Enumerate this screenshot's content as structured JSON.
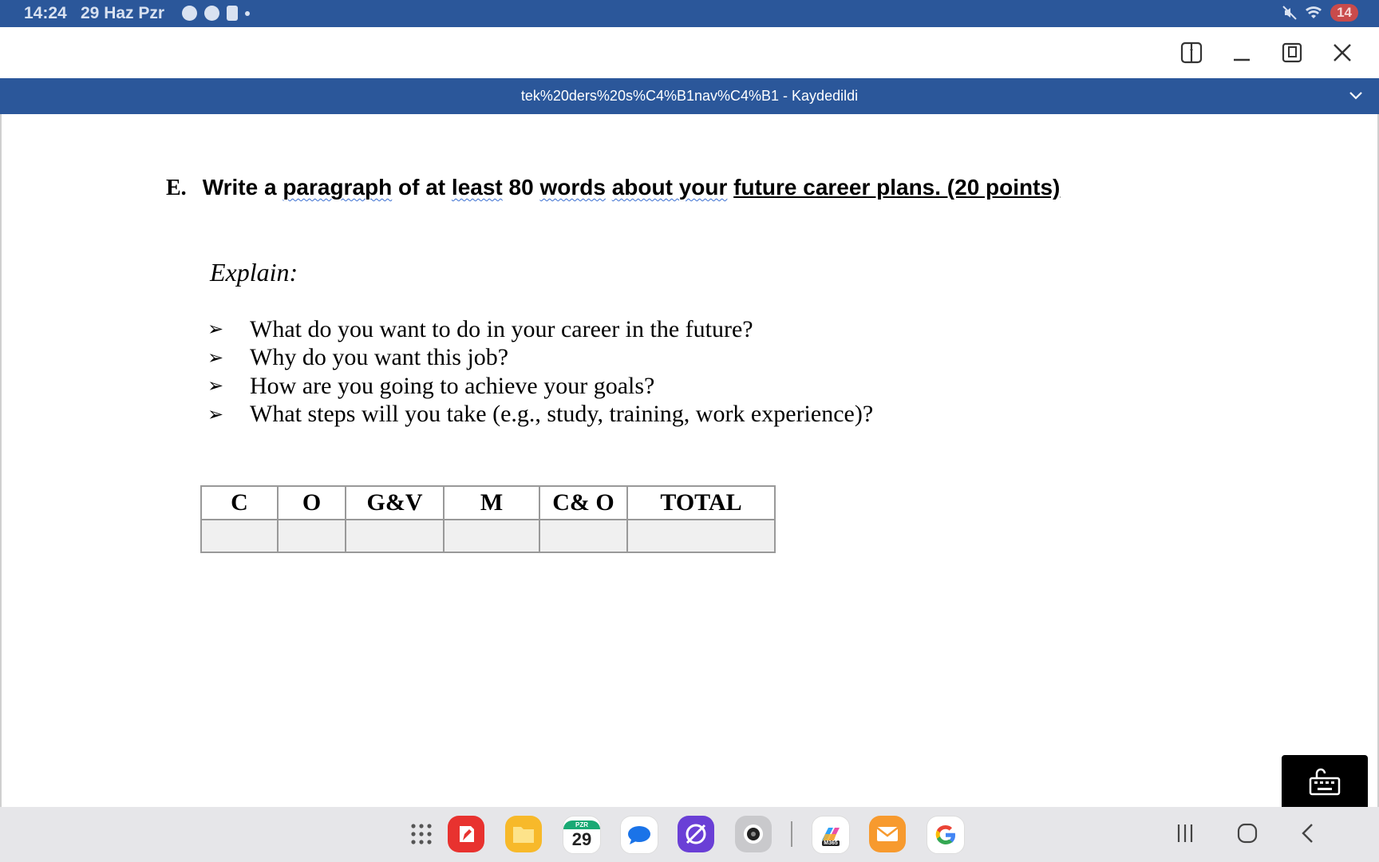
{
  "status_bar": {
    "time": "14:24",
    "date": "29 Haz Pzr",
    "battery": "14"
  },
  "title_bar": {
    "title": "tek%20ders%20s%C4%B1nav%C4%B1 - Kaydedildi"
  },
  "document": {
    "question_letter": "E.",
    "heading_parts": [
      {
        "text": "Write a ",
        "style": "plain"
      },
      {
        "text": "paragraph",
        "style": "wavy"
      },
      {
        "text": " of at ",
        "style": "plain"
      },
      {
        "text": "least",
        "style": "wavy"
      },
      {
        "text": " 80 ",
        "style": "plain"
      },
      {
        "text": "words",
        "style": "wavy"
      },
      {
        "text": " ",
        "style": "plain"
      },
      {
        "text": "about your",
        "style": "wavy"
      },
      {
        "text": " ",
        "style": "plain"
      },
      {
        "text": "future career plans. (20 points)",
        "style": "underline"
      }
    ],
    "explain_label": "Explain:",
    "bullets": [
      "What do you want to do in your career in the future?",
      "Why do you want this job?",
      "How are you going to achieve your goals?",
      "What steps will you take (e.g., study, training, work experience)?"
    ],
    "score_table": {
      "headers": [
        "C",
        "O",
        "G&V",
        "M",
        "C& O",
        "TOTAL"
      ],
      "values": [
        "",
        "",
        "",
        "",
        "",
        ""
      ]
    }
  },
  "taskbar": {
    "calendar_day": "29",
    "calendar_weekday": "PZR",
    "m365_label": "M365",
    "apps": [
      "app-drawer-icon",
      "notes-app-icon",
      "files-app-icon",
      "calendar-app-icon",
      "messages-app-icon",
      "internet-app-icon",
      "camera-app-icon",
      "m365-copilot-icon",
      "email-app-icon",
      "google-app-icon"
    ]
  },
  "colors": {
    "accent": "#2b579a",
    "battery": "#c94b4b",
    "spellcheck": "#3a6fd1"
  }
}
